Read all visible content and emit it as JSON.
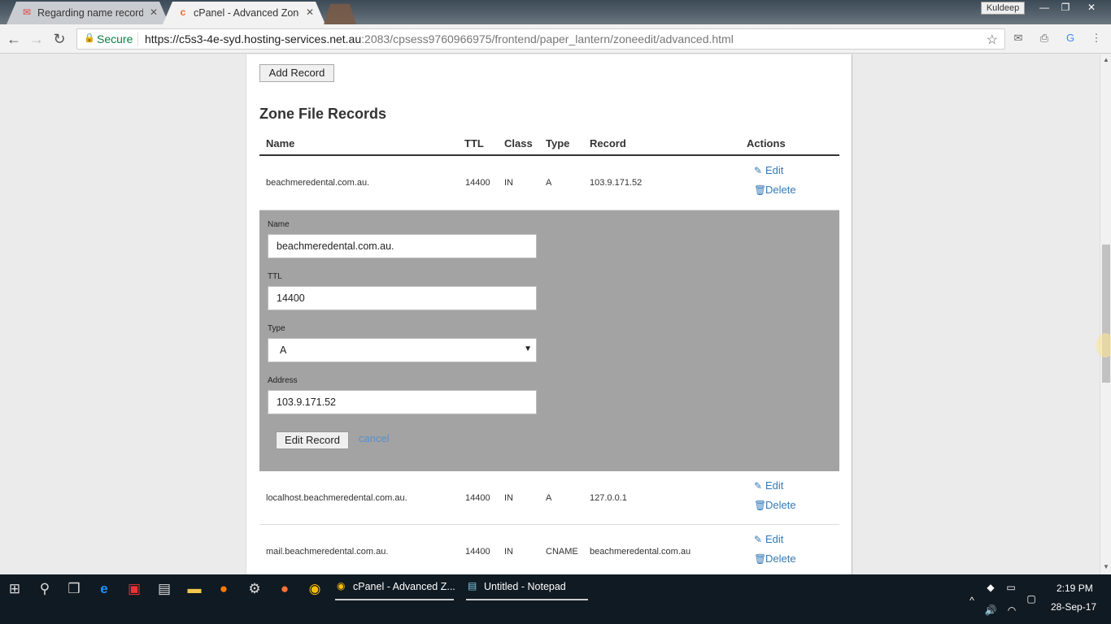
{
  "browser": {
    "tabs": [
      {
        "title": "Regarding name record",
        "close": "✕",
        "icon": "gmail-icon"
      },
      {
        "title": "cPanel - Advanced Zone",
        "close": "✕",
        "icon": "cpanel-icon"
      }
    ],
    "user": "Kuldeep",
    "window_controls": {
      "minimize": "—",
      "restore": "❐",
      "close": "✕"
    },
    "secure_label": "Secure",
    "url_host": "https://c5s3-4e-syd.hosting-services.net.au",
    "url_rest": ":2083/cpsess9760966975/frontend/paper_lantern/zoneedit/advanced.html",
    "nav": {
      "back": "←",
      "forward": "→",
      "reload": "↻",
      "star": "☆"
    }
  },
  "page": {
    "add_record_label": "Add Record",
    "section_title": "Zone File Records",
    "columns": [
      "Name",
      "TTL",
      "Class",
      "Type",
      "Record",
      "Actions"
    ],
    "actions": {
      "edit": "Edit",
      "delete": "Delete"
    },
    "rows": [
      {
        "name": "beachmeredental.com.au.",
        "ttl": "14400",
        "class": "IN",
        "type": "A",
        "record": "103.9.171.52"
      },
      {
        "name": "localhost.beachmeredental.com.au.",
        "ttl": "14400",
        "class": "IN",
        "type": "A",
        "record": "127.0.0.1"
      },
      {
        "name": "mail.beachmeredental.com.au.",
        "ttl": "14400",
        "class": "IN",
        "type": "CNAME",
        "record": "beachmeredental.com.au"
      }
    ],
    "edit_form": {
      "name_label": "Name",
      "name_value": "beachmeredental.com.au.",
      "ttl_label": "TTL",
      "ttl_value": "14400",
      "type_label": "Type",
      "type_value": "A",
      "address_label": "Address",
      "address_value": "103.9.171.52",
      "submit_label": "Edit Record",
      "cancel_label": "cancel"
    }
  },
  "taskbar": {
    "apps": [
      {
        "title": "cPanel - Advanced Z...",
        "icon": "chrome-icon"
      },
      {
        "title": "Untitled - Notepad",
        "icon": "notepad-icon"
      }
    ],
    "time": "2:19 PM",
    "date": "28-Sep-17"
  },
  "colors": {
    "link": "#337ab7",
    "panel": "#a3a3a3",
    "secure": "#0b8043",
    "taskbar": "#101a22"
  }
}
